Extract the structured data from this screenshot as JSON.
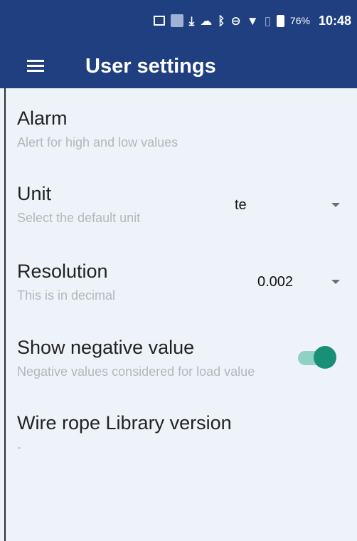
{
  "status_bar": {
    "icons": [
      "image-icon",
      "app-icon",
      "download-icon",
      "cloud-icon",
      "bluetooth-icon",
      "do-not-disturb-icon",
      "vpn-icon",
      "no-sim-icon",
      "battery-icon"
    ],
    "battery": "76%",
    "time": "10:48"
  },
  "app_bar": {
    "title": "User settings",
    "menu_icon": "menu-icon"
  },
  "settings": {
    "alarm": {
      "title": "Alarm",
      "subtitle": "Alert for high and low values"
    },
    "unit": {
      "title": "Unit",
      "subtitle": "Select the default unit",
      "value": "te"
    },
    "resolution": {
      "title": "Resolution",
      "subtitle": "This is in decimal",
      "value": "0.002"
    },
    "show_negative": {
      "title": "Show negative value",
      "subtitle": "Negative values considered for load value",
      "enabled": true
    },
    "library_version": {
      "title": "Wire rope Library version",
      "subtitle": "-"
    }
  },
  "colors": {
    "app_bar": "#1f3f80",
    "background": "#eef3fa",
    "toggle_on": "#1a8f77"
  }
}
